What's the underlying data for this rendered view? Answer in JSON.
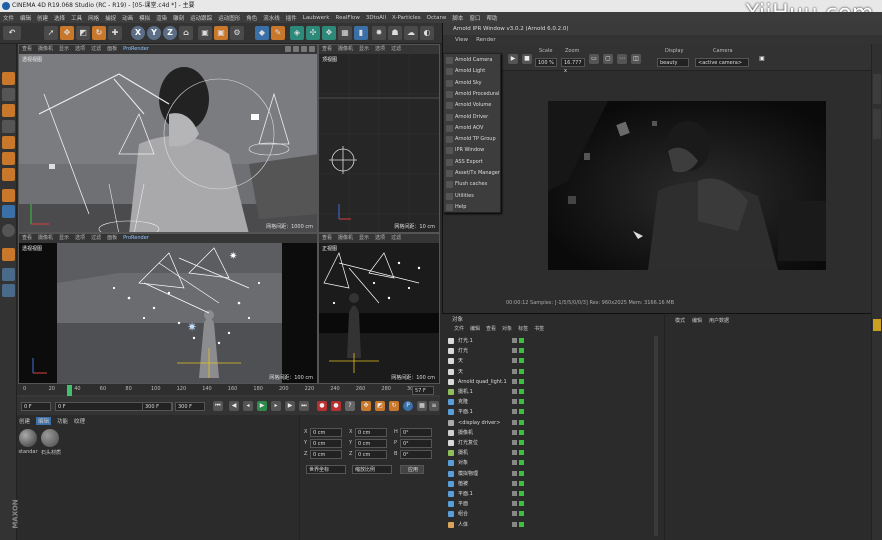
{
  "window": {
    "title": "CINEMA 4D R19.068 Studio (RC - R19) - [05-课堂.c4d *] - 主要"
  },
  "watermark": "YiiHuu.com",
  "menu": [
    "文件",
    "编辑",
    "创建",
    "选择",
    "工具",
    "网格",
    "捕捉",
    "动画",
    "模拟",
    "渲染",
    "雕刻",
    "运动跟踪",
    "运动图形",
    "角色",
    "流水线",
    "插件",
    "Laubwerk",
    "RealFlow",
    "3DtoAll",
    "X-Particles",
    "Octane",
    "脚本",
    "窗口",
    "帮助"
  ],
  "viewport_menu": {
    "items": [
      "查看",
      "摄像机",
      "显示",
      "选项",
      "过滤",
      "面板"
    ],
    "prorender": "ProRender"
  },
  "viewports": [
    {
      "name": "透视视图",
      "scale": "网格间距：1000 cm"
    },
    {
      "name": "顶视图",
      "scale": "网格间距：10 cm"
    },
    {
      "name": "透视视图",
      "scale": "网格间距：100 cm"
    },
    {
      "name": "正视图",
      "scale": "网格间距：100 cm"
    }
  ],
  "timeline": {
    "ticks": [
      "0",
      "20",
      "40",
      "60",
      "80",
      "100",
      "120",
      "140",
      "160",
      "180",
      "200",
      "220",
      "240",
      "260",
      "280",
      "300"
    ],
    "current_frame_box": "57 F",
    "start": "0 F",
    "start2": "0 F",
    "end": "300 F",
    "end2": "300 F"
  },
  "material_panel": {
    "tabs": [
      "创建",
      "编辑",
      "功能",
      "纹理"
    ],
    "materials": [
      "standar",
      "石头材质"
    ]
  },
  "coords": {
    "rows": [
      [
        "X",
        "0 cm",
        "X",
        "0 cm",
        "H",
        "0°"
      ],
      [
        "Y",
        "0 cm",
        "Y",
        "0 cm",
        "P",
        "0°"
      ],
      [
        "Z",
        "0 cm",
        "Z",
        "0 cm",
        "B",
        "0°"
      ]
    ],
    "mode": "世界坐标",
    "size_mode": "缩放比例",
    "apply": "应用"
  },
  "arnold": {
    "title": "Arnold IPR Window v3.0.2 (Arnold 6.0.2.0)",
    "menu": [
      "View",
      "Render"
    ],
    "scale_label": "Scale",
    "scale_value": "100 %",
    "zoom_label": "Zoom",
    "zoom_value": "16.777 x",
    "display_label": "Display",
    "display_value": "beauty",
    "camera_label": "Camera",
    "camera_value": "<active camera>",
    "status": "00:00:12  Samples: [-1/5/5/0/0/3]  Res: 960x2025  Mem: 3166.16 MB"
  },
  "arnold_dropdown": [
    "Arnold Camera",
    "Arnold Light",
    "Arnold Sky",
    "Arnold Procedural",
    "Arnold Volume",
    "Arnold Driver",
    "Arnold AOV",
    "Arnold TP Group",
    "IPR Window",
    "ASS Export",
    "Asset/Tx Manager",
    "Flush caches",
    "Utilities",
    "Help"
  ],
  "object_manager": {
    "tabs": [
      "对象"
    ],
    "menu": [
      "文件",
      "编辑",
      "查看",
      "对象",
      "标签",
      "书签"
    ],
    "rows": [
      {
        "name": "灯光.1",
        "color": "#d9d9d9"
      },
      {
        "name": "灯光",
        "color": "#d9d9d9"
      },
      {
        "name": "天",
        "color": "#d9d9d9"
      },
      {
        "name": "天",
        "color": "#d9d9d9"
      },
      {
        "name": "Arnold quad_light.1",
        "color": "#d9d9d9"
      },
      {
        "name": "摄机.1",
        "color": "#8fbf5a"
      },
      {
        "name": "克隆",
        "color": "#5a9ed9"
      },
      {
        "name": "平面.1",
        "color": "#5a9ed9"
      },
      {
        "name": "<display driver>",
        "color": "#aaaaaa"
      },
      {
        "name": "摄像机",
        "color": "#cfcfcf"
      },
      {
        "name": "灯光复位",
        "color": "#d9d9d9"
      },
      {
        "name": "摄机",
        "color": "#8fbf5a"
      },
      {
        "name": "对象",
        "color": "#5a9ed9"
      },
      {
        "name": "模拟物理",
        "color": "#5a9ed9"
      },
      {
        "name": "植被",
        "color": "#5a9ed9"
      },
      {
        "name": "平面.1",
        "color": "#5a9ed9"
      },
      {
        "name": "平面",
        "color": "#5a9ed9"
      },
      {
        "name": "组合",
        "color": "#5a9ed9"
      },
      {
        "name": "人体",
        "color": "#d9a35a"
      }
    ]
  },
  "attr_manager": {
    "menu": [
      "模式",
      "编辑",
      "用户数据"
    ]
  },
  "colors": {
    "accent": "#3a6fa8",
    "highlight": "#c9772a"
  }
}
